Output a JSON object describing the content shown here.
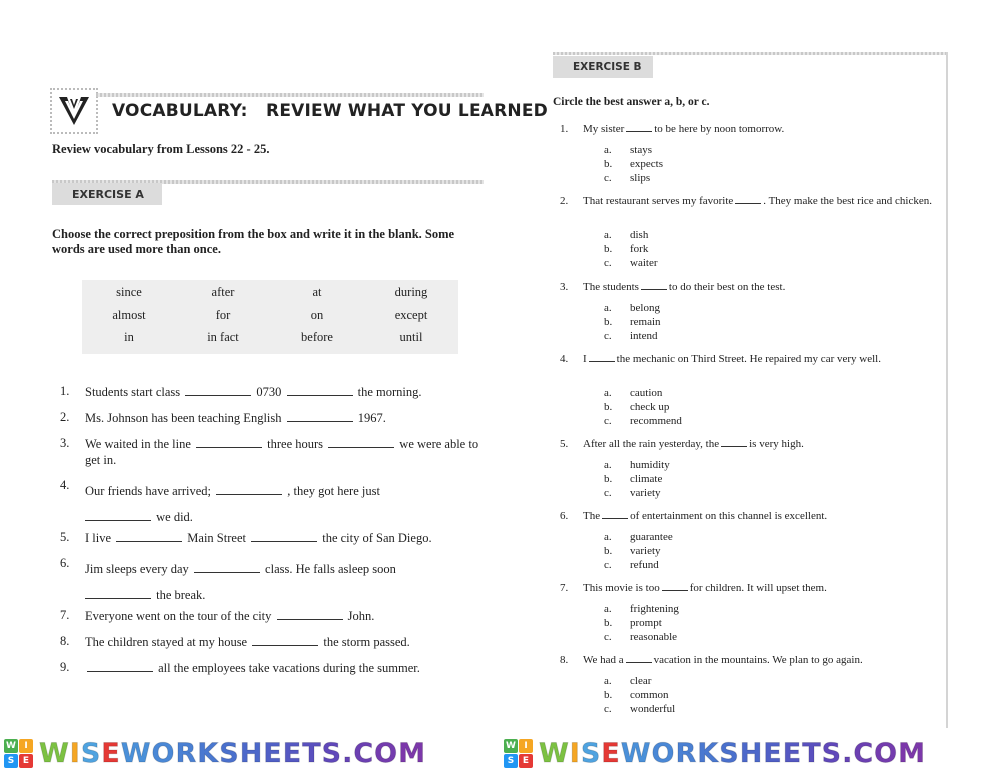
{
  "header": {
    "title": "VOCABULARY:   REVIEW WHAT YOU LEARNED",
    "subtitle": "Review vocabulary from Lessons 22 - 25."
  },
  "exercise_a": {
    "label": "EXERCISE A",
    "instructions": "Choose the correct preposition from the box and write it in the blank. Some words are used more than once.",
    "word_box": [
      "since",
      "after",
      "at",
      "during",
      "almost",
      "for",
      "on",
      "except",
      "in",
      "in fact",
      "before",
      "until"
    ],
    "questions": [
      {
        "num": "1.",
        "parts": [
          "Students start class",
          "0730",
          "the morning."
        ]
      },
      {
        "num": "2.",
        "parts": [
          "Ms. Johnson has been teaching English",
          "1967."
        ]
      },
      {
        "num": "3.",
        "parts": [
          "We waited in the line",
          "three hours",
          "we were able to get in."
        ]
      },
      {
        "num": "4.",
        "parts": [
          "Our friends have arrived;",
          ", they got here just",
          "we did."
        ]
      },
      {
        "num": "5.",
        "parts": [
          "I live",
          "Main Street",
          "the city of San Diego."
        ]
      },
      {
        "num": "6.",
        "parts": [
          "Jim sleeps every day",
          "class. He falls asleep soon",
          "the break."
        ]
      },
      {
        "num": "7.",
        "parts": [
          "Everyone went on the tour of the city",
          "John."
        ]
      },
      {
        "num": "8.",
        "parts": [
          "The children stayed at my house",
          "the storm passed."
        ]
      },
      {
        "num": "9.",
        "parts": [
          "",
          "all the employees take vacations during the summer."
        ]
      }
    ]
  },
  "exercise_b": {
    "label": "EXERCISE B",
    "instructions": "Circle the best answer a, b, or c.",
    "questions": [
      {
        "num": "1.",
        "before": "My sister",
        "after": "to be here by noon tomorrow.",
        "options": [
          [
            "a.",
            "stays"
          ],
          [
            "b.",
            "expects"
          ],
          [
            "c.",
            "slips"
          ]
        ]
      },
      {
        "num": "2.",
        "before": "That restaurant serves my favorite",
        "after": ". They make the best rice and chicken.",
        "options": [
          [
            "a.",
            "dish"
          ],
          [
            "b.",
            "fork"
          ],
          [
            "c.",
            "waiter"
          ]
        ]
      },
      {
        "num": "3.",
        "before": "The students",
        "after": "to do their best on the test.",
        "options": [
          [
            "a.",
            "belong"
          ],
          [
            "b.",
            "remain"
          ],
          [
            "c.",
            "intend"
          ]
        ]
      },
      {
        "num": "4.",
        "before": "I",
        "after": "the mechanic on Third Street. He repaired my car very well.",
        "options": [
          [
            "a.",
            "caution"
          ],
          [
            "b.",
            "check up"
          ],
          [
            "c.",
            "recommend"
          ]
        ]
      },
      {
        "num": "5.",
        "before": "After all the rain yesterday, the",
        "after": "is very high.",
        "options": [
          [
            "a.",
            "humidity"
          ],
          [
            "b.",
            "climate"
          ],
          [
            "c.",
            "variety"
          ]
        ]
      },
      {
        "num": "6.",
        "before": "The",
        "after": "of entertainment on this channel is excellent.",
        "options": [
          [
            "a.",
            "guarantee"
          ],
          [
            "b.",
            "variety"
          ],
          [
            "c.",
            "refund"
          ]
        ]
      },
      {
        "num": "7.",
        "before": "This movie is too",
        "after": "for children. It will upset them.",
        "options": [
          [
            "a.",
            "frightening"
          ],
          [
            "b.",
            "prompt"
          ],
          [
            "c.",
            "reasonable"
          ]
        ]
      },
      {
        "num": "8.",
        "before": "We had a",
        "after": "vacation in the mountains. We plan to go again.",
        "options": [
          [
            "a.",
            "clear"
          ],
          [
            "b.",
            "common"
          ],
          [
            "c.",
            "wonderful"
          ]
        ]
      }
    ]
  },
  "footer": {
    "logo_letters": [
      "W",
      "I",
      "S",
      "E"
    ],
    "logo_colors": [
      "#4caf50",
      "#f5a623",
      "#2196f3",
      "#e53935"
    ],
    "brand_letters": [
      "W",
      "I",
      "S",
      "E",
      "W",
      "O",
      "R",
      "K",
      "S",
      "H",
      "E",
      "E",
      "T",
      "S",
      ".",
      "C",
      "O",
      "M"
    ],
    "brand_colors": [
      "#7cc142",
      "#f5a623",
      "#4fa3e0",
      "#e53935",
      "#4a90d9",
      "#4a88d6",
      "#4a80d3",
      "#4a78d0",
      "#4a70cd",
      "#4c68ca",
      "#5060c6",
      "#5558c2",
      "#5a50be",
      "#6048ba",
      "#6644b6",
      "#6c40b2",
      "#743cae",
      "#7c38aa"
    ],
    "brand_text": "WISEWORKSHEETS.COM"
  }
}
